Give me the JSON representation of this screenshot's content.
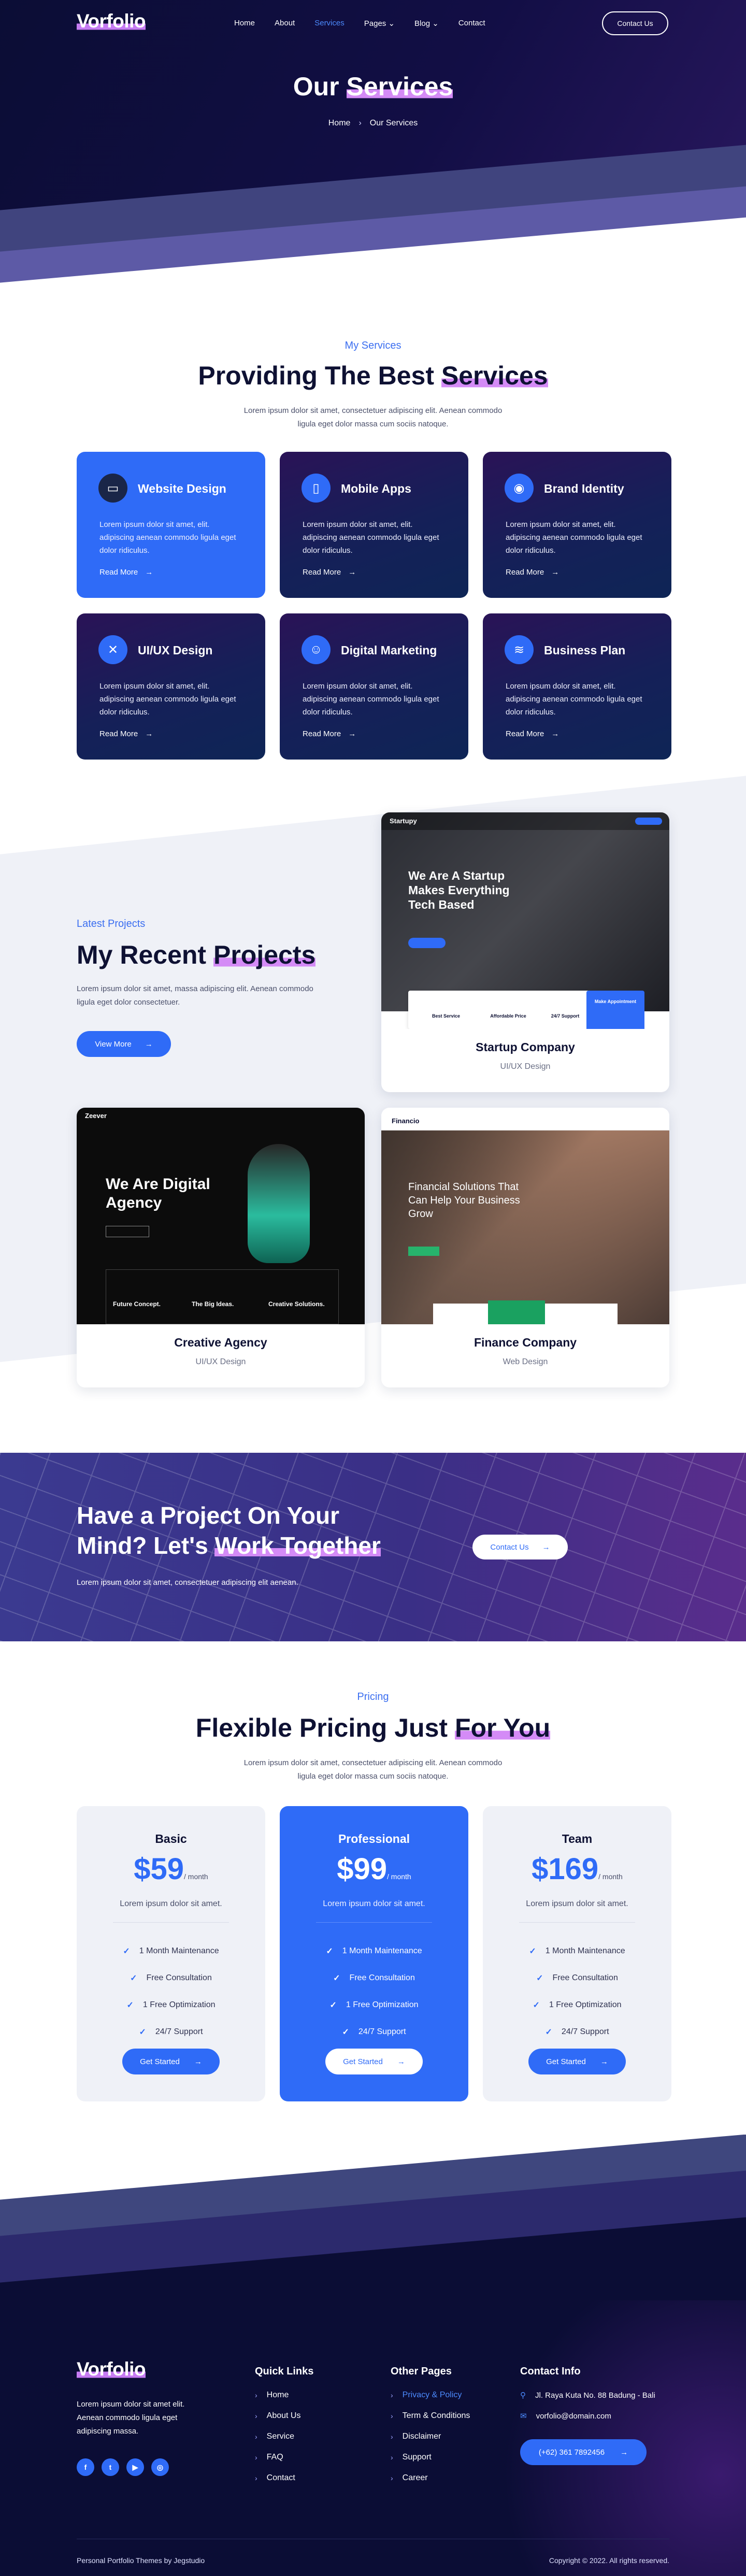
{
  "brand": {
    "logo_text": "Vorfolio"
  },
  "nav": {
    "items": [
      {
        "label": "Home"
      },
      {
        "label": "About"
      },
      {
        "label": "Services"
      },
      {
        "label": "Pages ⌄"
      },
      {
        "label": "Blog ⌄"
      },
      {
        "label": "Contact"
      }
    ],
    "cta": "Contact Us"
  },
  "hero": {
    "title_a": "Our ",
    "title_b": "Services",
    "crumb_home": "Home",
    "crumb_sep": "›",
    "crumb_current": "Our Services"
  },
  "services": {
    "tag": "My Services",
    "title_a": "Providing The Best ",
    "title_b": "Services",
    "lead": "Lorem ipsum dolor sit amet, consectetuer adipiscing elit. Aenean commodo ligula eget dolor massa cum sociis natoque.",
    "items": [
      {
        "title": "Website Design",
        "desc": "Lorem ipsum dolor sit amet, elit. adipiscing aenean commodo ligula eget dolor ridiculus.",
        "link": "Read More"
      },
      {
        "title": "Mobile Apps",
        "desc": "Lorem ipsum dolor sit amet, elit. adipiscing aenean commodo ligula eget dolor ridiculus.",
        "link": "Read More"
      },
      {
        "title": "Brand Identity",
        "desc": "Lorem ipsum dolor sit amet, elit. adipiscing aenean commodo ligula eget dolor ridiculus.",
        "link": "Read More"
      },
      {
        "title": "UI/UX Design",
        "desc": "Lorem ipsum dolor sit amet, elit. adipiscing aenean commodo ligula eget dolor ridiculus.",
        "link": "Read More"
      },
      {
        "title": "Digital Marketing",
        "desc": "Lorem ipsum dolor sit amet, elit. adipiscing aenean commodo ligula eget dolor ridiculus.",
        "link": "Read More"
      },
      {
        "title": "Business Plan",
        "desc": "Lorem ipsum dolor sit amet, elit. adipiscing aenean commodo ligula eget dolor ridiculus.",
        "link": "Read More"
      }
    ]
  },
  "projects": {
    "tag": "Latest Projects",
    "title_a": "My Recent ",
    "title_b": "Projects",
    "lead": "Lorem ipsum dolor sit amet, massa adipiscing elit. Aenean commodo ligula eget dolor consectetuer.",
    "cta": "View More",
    "items": [
      {
        "title": "Startup Company",
        "category": "UI/UX Design",
        "logo": "Startupy",
        "headline": "We Are A Startup Makes Everything Tech Based",
        "f1": "Best Service",
        "f2": "Affordable Price",
        "f3": "24/7 Support",
        "f4": "Make Appointment"
      },
      {
        "title": "Creative Agency",
        "category": "UI/UX Design",
        "logo": "Zeever",
        "headline": "We Are Digital Agency",
        "f1": "Future Concept.",
        "f2": "The Big Ideas.",
        "f3": "Creative Solutions."
      },
      {
        "title": "Finance Company",
        "category": "Web Design",
        "logo": "Financio",
        "headline": "Financial Solutions That Can Help Your Business Grow"
      }
    ]
  },
  "cta": {
    "title_a": "Have a Project On Your",
    "title_b": "Mind? Let's ",
    "title_c": "Work Together",
    "desc": "Lorem ipsum dolor sit amet, consectetuer adipiscing elit aenean.",
    "button": "Contact Us"
  },
  "pricing": {
    "tag": "Pricing",
    "title_a": "Flexible Pricing Just ",
    "title_b": "For You",
    "lead": "Lorem ipsum dolor sit amet, consectetuer adipiscing elit. Aenean commodo ligula eget dolor massa cum sociis natoque.",
    "plans": [
      {
        "name": "Basic",
        "price": "$59",
        "period": "/ month",
        "desc": "Lorem ipsum dolor sit amet.",
        "features": [
          "1 Month Maintenance",
          "Free Consultation",
          "1 Free Optimization",
          "24/7 Support"
        ],
        "button": "Get Started"
      },
      {
        "name": "Professional",
        "price": "$99",
        "period": "/ month",
        "desc": "Lorem ipsum dolor sit amet.",
        "features": [
          "1 Month Maintenance",
          "Free Consultation",
          "1 Free Optimization",
          "24/7 Support"
        ],
        "button": "Get Started"
      },
      {
        "name": "Team",
        "price": "$169",
        "period": "/ month",
        "desc": "Lorem ipsum dolor sit amet.",
        "features": [
          "1 Month Maintenance",
          "Free Consultation",
          "1 Free Optimization",
          "24/7 Support"
        ],
        "button": "Get Started"
      }
    ]
  },
  "footer": {
    "about": "Lorem ipsum dolor sit amet elit. Aenean commodo ligula eget adipiscing massa.",
    "social": [
      "f",
      "t",
      "▶",
      "◎"
    ],
    "quick_title": "Quick Links",
    "quick": [
      "Home",
      "About Us",
      "Service",
      "FAQ",
      "Contact"
    ],
    "other_title": "Other Pages",
    "other": [
      "Privacy & Policy",
      "Term & Conditions",
      "Disclaimer",
      "Support",
      "Career"
    ],
    "contact_title": "Contact Info",
    "address": "Jl. Raya Kuta No. 88 Badung - Bali",
    "email": "vorfolio@domain.com",
    "phone": "(+62) 361 7892456",
    "left_copy": "Personal Portfolio Themes by Jegstudio",
    "right_copy": "Copyright © 2022. All rights reserved."
  }
}
